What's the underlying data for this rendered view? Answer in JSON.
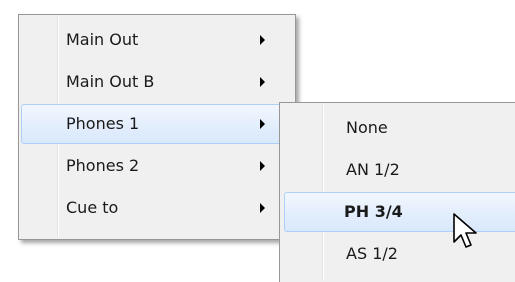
{
  "main_menu": {
    "items": [
      {
        "label": "Main Out",
        "has_submenu": true
      },
      {
        "label": "Main Out B",
        "has_submenu": true
      },
      {
        "label": "Phones 1",
        "has_submenu": true,
        "highlighted": true
      },
      {
        "label": "Phones 2",
        "has_submenu": true
      },
      {
        "label": "Cue to",
        "has_submenu": true
      }
    ]
  },
  "submenu": {
    "items": [
      {
        "label": "None"
      },
      {
        "label": "AN 1/2"
      },
      {
        "label": "PH 3/4",
        "highlighted": true,
        "bold": true
      },
      {
        "label": "AS 1/2"
      }
    ]
  },
  "icons": {
    "submenu_arrow": "chevron-right-icon",
    "pointer": "mouse-pointer-icon"
  },
  "colors": {
    "menu_background": "#f0f0f0",
    "menu_border": "#979797",
    "highlight_border": "#aecff7",
    "highlight_fill": "#e3eefc"
  }
}
